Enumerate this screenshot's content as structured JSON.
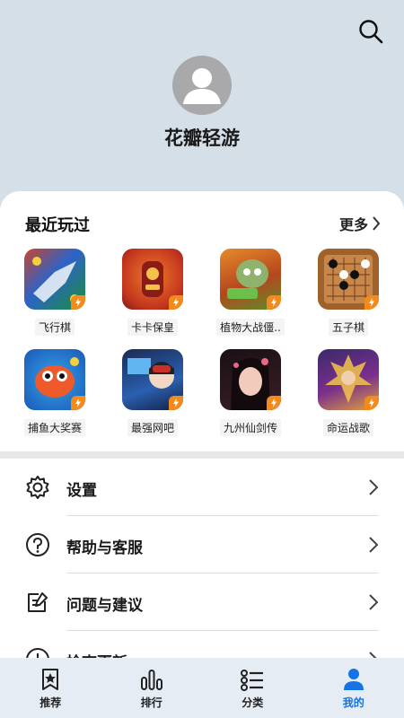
{
  "profile": {
    "username": "花瓣轻游"
  },
  "recent": {
    "title": "最近玩过",
    "more_label": "更多",
    "games": [
      {
        "name": "飞行棋",
        "icon": "airplane-chess-game-icon"
      },
      {
        "name": "卡卡保皇",
        "icon": "robot-card-game-icon"
      },
      {
        "name": "植物大战僵..",
        "icon": "zombie-game-icon"
      },
      {
        "name": "五子棋",
        "icon": "gomoku-game-icon"
      },
      {
        "name": "捕鱼大奖赛",
        "icon": "fish-game-icon"
      },
      {
        "name": "最强网吧",
        "icon": "internet-cafe-game-icon"
      },
      {
        "name": "九州仙剑传",
        "icon": "fantasy-girl-game-icon"
      },
      {
        "name": "命运战歌",
        "icon": "warrior-game-icon"
      }
    ]
  },
  "settings": [
    {
      "label": "设置",
      "icon": "gear-icon"
    },
    {
      "label": "帮助与客服",
      "icon": "help-icon"
    },
    {
      "label": "问题与建议",
      "icon": "feedback-icon"
    },
    {
      "label": "检查更新",
      "icon": "update-icon"
    }
  ],
  "tabs": [
    {
      "label": "推荐",
      "icon": "recommend-icon"
    },
    {
      "label": "排行",
      "icon": "ranking-icon"
    },
    {
      "label": "分类",
      "icon": "category-icon"
    },
    {
      "label": "我的",
      "icon": "profile-icon",
      "active": true
    }
  ],
  "colors": {
    "accent": "#1673e6",
    "header_bg": "#d5dfe8",
    "badge": "#f28a1c"
  }
}
